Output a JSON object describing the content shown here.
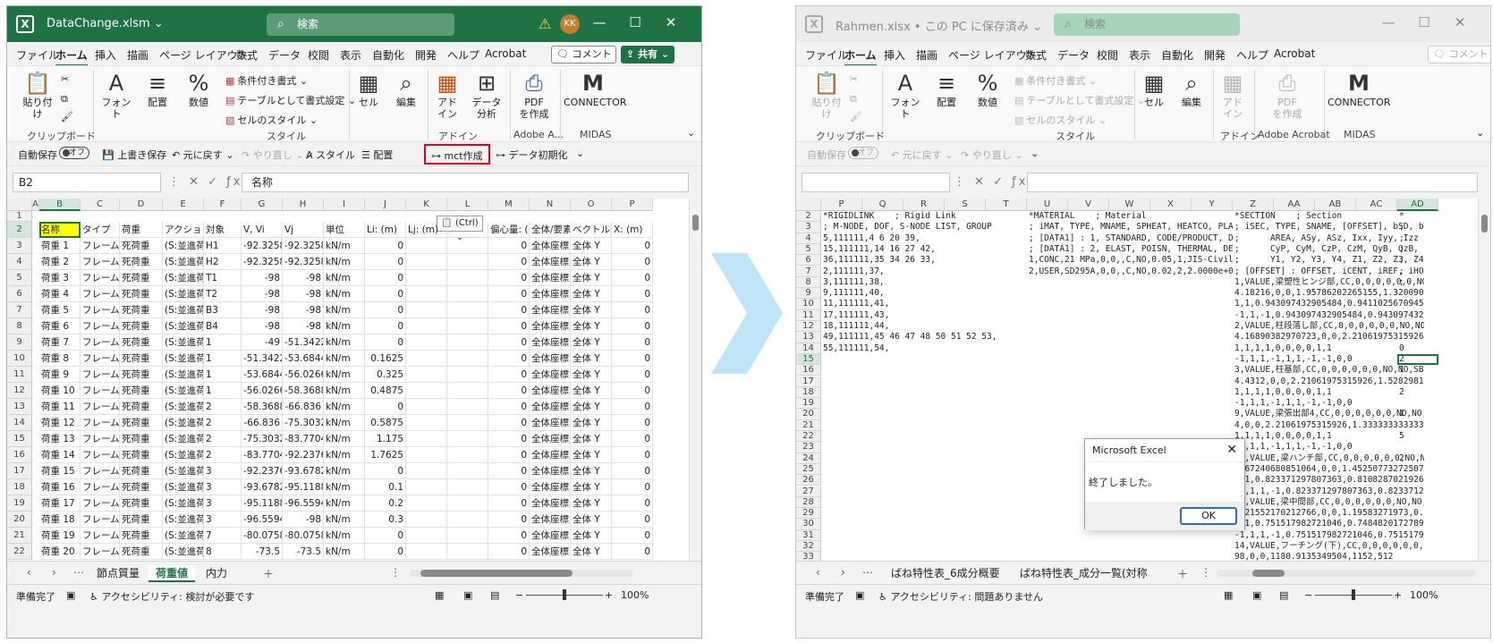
{
  "left": {
    "title": {
      "filename": "DataChange.xlsm ⌄",
      "search": "検索",
      "avatar": "KK"
    },
    "menu": {
      "tabs": [
        "ファイル",
        "ホーム",
        "挿入",
        "描画",
        "ページ レイアウト",
        "数式",
        "データ",
        "校閲",
        "表示",
        "自動化",
        "開発",
        "ヘルプ",
        "Acrobat"
      ],
      "comment": "コメント",
      "share": "共有 ⌄"
    },
    "ribbon": {
      "paste": "貼り付け",
      "font": "フォント",
      "align": "配置",
      "number": "数値",
      "cond_format": "条件付き書式 ⌄",
      "table_format": "テーブルとして書式設定 ⌄",
      "cell_style": "セルのスタイル ⌄",
      "cell": "セル",
      "edit": "編集",
      "addin": "アド\nイン",
      "analyze": "データ\n分析",
      "pdf": "PDF\nを作成",
      "connector": "CONNECTOR",
      "groups": [
        "クリップボード",
        "スタイル",
        "アドイン",
        "Adobe A...",
        "MIDAS"
      ]
    },
    "qat": {
      "autosave": "自動保存",
      "toggle": "オフ",
      "overwrite": "上書き保存",
      "undo": "元に戻す ⌄",
      "redo": "やり直し ⌄",
      "style": "スタイル",
      "align": "配置",
      "mct": "mct作成",
      "init": "データ初期化"
    },
    "formula": {
      "namebox": "B2",
      "value": "名称"
    },
    "columns": [
      "A",
      "B",
      "C",
      "D",
      "E",
      "F",
      "G",
      "H",
      "I",
      "J",
      "K",
      "L",
      "M",
      "N",
      "O",
      "P"
    ],
    "header_row": [
      "名称",
      "タイプ",
      "荷重",
      "アクション",
      "対象",
      "V, Vi",
      "Vj",
      "単位",
      "Li: (m)",
      "Lj: (m)",
      "",
      "偏心量: (",
      "全体/要素",
      "ベクトル方",
      "X: (m)"
    ],
    "ctrl_paste": "(Ctrl)",
    "rows": [
      [
        "荷重 1",
        "フレーム要",
        "死荷重",
        "(S:並進荷重",
        "H1",
        "-92.3258",
        "-92.3258",
        "kN/m",
        "0",
        "",
        "",
        "0",
        "全体座標系",
        "全体 Y",
        "0"
      ],
      [
        "荷重 2",
        "フレーム要",
        "死荷重",
        "(S:並進荷重",
        "H2",
        "-92.3258",
        "-92.3258",
        "kN/m",
        "0",
        "",
        "",
        "0",
        "全体座標系",
        "全体 Y",
        "0"
      ],
      [
        "荷重 3",
        "フレーム要",
        "死荷重",
        "(S:並進荷重",
        "T1",
        "-98",
        "-98",
        "kN/m",
        "0",
        "",
        "",
        "0",
        "全体座標系",
        "全体 Y",
        "0"
      ],
      [
        "荷重 4",
        "フレーム要",
        "死荷重",
        "(S:並進荷重",
        "T2",
        "-98",
        "-98",
        "kN/m",
        "0",
        "",
        "",
        "0",
        "全体座標系",
        "全体 Y",
        "0"
      ],
      [
        "荷重 5",
        "フレーム要",
        "死荷重",
        "(S:並進荷重",
        "B3",
        "-98",
        "-98",
        "kN/m",
        "0",
        "",
        "",
        "0",
        "全体座標系",
        "全体 Y",
        "0"
      ],
      [
        "荷重 6",
        "フレーム要",
        "死荷重",
        "(S:並進荷重",
        "B4",
        "-98",
        "-98",
        "kN/m",
        "0",
        "",
        "",
        "0",
        "全体座標系",
        "全体 Y",
        "0"
      ],
      [
        "荷重 7",
        "フレーム要",
        "死荷重",
        "(S:並進荷重",
        "1",
        "-49",
        "-51.3422",
        "kN/m",
        "0",
        "",
        "",
        "0",
        "全体座標系",
        "全体 Y",
        "0"
      ],
      [
        "荷重 8",
        "フレーム要",
        "死荷重",
        "(S:並進荷重",
        "1",
        "-51.3422",
        "-53.6844",
        "kN/m",
        "0.1625",
        "",
        "",
        "0",
        "全体座標系",
        "全体 Y",
        "0"
      ],
      [
        "荷重 9",
        "フレーム要",
        "死荷重",
        "(S:並進荷重",
        "1",
        "-53.6844",
        "-56.0266",
        "kN/m",
        "0.325",
        "",
        "",
        "0",
        "全体座標系",
        "全体 Y",
        "0"
      ],
      [
        "荷重 10",
        "フレーム要",
        "死荷重",
        "(S:並進荷重",
        "1",
        "-56.0266",
        "-58.3688",
        "kN/m",
        "0.4875",
        "",
        "",
        "0",
        "全体座標系",
        "全体 Y",
        "0"
      ],
      [
        "荷重 11",
        "フレーム要",
        "死荷重",
        "(S:並進荷重",
        "2",
        "-58.3688",
        "-66.836",
        "kN/m",
        "0",
        "",
        "",
        "0",
        "全体座標系",
        "全体 Y",
        "0"
      ],
      [
        "荷重 12",
        "フレーム要",
        "死荷重",
        "(S:並進荷重",
        "2",
        "-66.836",
        "-75.3032",
        "kN/m",
        "0.5875",
        "",
        "",
        "0",
        "全体座標系",
        "全体 Y",
        "0"
      ],
      [
        "荷重 13",
        "フレーム要",
        "死荷重",
        "(S:並進荷重",
        "2",
        "-75.3032",
        "-83.7704",
        "kN/m",
        "1.175",
        "",
        "",
        "0",
        "全体座標系",
        "全体 Y",
        "0"
      ],
      [
        "荷重 14",
        "フレーム要",
        "死荷重",
        "(S:並進荷重",
        "2",
        "-83.7704",
        "-92.2376",
        "kN/m",
        "1.7625",
        "",
        "",
        "0",
        "全体座標系",
        "全体 Y",
        "0"
      ],
      [
        "荷重 15",
        "フレーム要",
        "死荷重",
        "(S:並進荷重",
        "3",
        "-92.2376",
        "-93.6782",
        "kN/m",
        "0",
        "",
        "",
        "0",
        "全体座標系",
        "全体 Y",
        "0"
      ],
      [
        "荷重 16",
        "フレーム要",
        "死荷重",
        "(S:並進荷重",
        "3",
        "-93.6782",
        "-95.1188",
        "kN/m",
        "0.1",
        "",
        "",
        "0",
        "全体座標系",
        "全体 Y",
        "0"
      ],
      [
        "荷重 17",
        "フレーム要",
        "死荷重",
        "(S:並進荷重",
        "3",
        "-95.1188",
        "-96.5594",
        "kN/m",
        "0.2",
        "",
        "",
        "0",
        "全体座標系",
        "全体 Y",
        "0"
      ],
      [
        "荷重 18",
        "フレーム要",
        "死荷重",
        "(S:並進荷重",
        "3",
        "-96.5594",
        "-98",
        "kN/m",
        "0.3",
        "",
        "",
        "0",
        "全体座標系",
        "全体 Y",
        "0"
      ],
      [
        "荷重 19",
        "フレーム要",
        "死荷重",
        "(S:並進荷重",
        "7",
        "-80.0758",
        "-80.0758",
        "kN/m",
        "0",
        "",
        "",
        "0",
        "全体座標系",
        "全体 Y",
        "0"
      ],
      [
        "荷重 20",
        "フレーム要",
        "死荷重",
        "(S:並進荷重",
        "8",
        "-73.5",
        "-73.5",
        "kN/m",
        "0",
        "",
        "",
        "0",
        "全体座標系",
        "全体 Y",
        "0"
      ]
    ],
    "row_numbers": [
      "1",
      "2",
      "3",
      "4",
      "5",
      "6",
      "7",
      "8",
      "9",
      "10",
      "11",
      "12",
      "13",
      "14",
      "15",
      "16",
      "17",
      "18",
      "19",
      "20",
      "21",
      "22"
    ],
    "sheets": [
      "節点質量",
      "荷重値",
      "内力"
    ],
    "status": {
      "ready": "準備完了",
      "access": "アクセシビリティ: 検討が必要です",
      "zoom": "100%"
    }
  },
  "right": {
    "title": {
      "filename": "Rahmen.xlsx • この PC に保存済み ⌄",
      "search": "検索"
    },
    "menu": {
      "tabs": [
        "ファイル",
        "ホーム",
        "挿入",
        "描画",
        "ページ レイアウト",
        "数式",
        "データ",
        "校閲",
        "表示",
        "自動化",
        "開発",
        "ヘルプ",
        "Acrobat"
      ],
      "comment": "コメント"
    },
    "ribbon": {
      "paste": "貼り付け",
      "font": "フォント",
      "align": "配置",
      "number": "数値",
      "cond_format": "条件付き書式 ⌄",
      "table_format": "テーブルとして書式設定 ⌄",
      "cell_style": "セルのスタイル ⌄",
      "cell": "セル",
      "edit": "編集",
      "addin": "アド\nイン",
      "pdf": "PDF\nを作成",
      "connector": "CONNECTOR",
      "groups": [
        "クリップボード",
        "スタイル",
        "アドイン",
        "Adobe Acrobat",
        "MIDAS"
      ]
    },
    "qat": {
      "autosave": "自動保存",
      "toggle": "オフ",
      "undo": "元に戻す ⌄",
      "redo": "やり直し ⌄"
    },
    "columns": [
      "P",
      "Q",
      "R",
      "S",
      "T",
      "U",
      "V",
      "W",
      "X",
      "Y",
      "Z",
      "AA",
      "AB",
      "AC",
      "AD"
    ],
    "row_numbers": [
      "2",
      "3",
      "4",
      "5",
      "6",
      "7",
      "8",
      "9",
      "10",
      "11",
      "12",
      "13",
      "14",
      "15",
      "16",
      "17",
      "18",
      "19",
      "20",
      "21",
      "22",
      "23",
      "24",
      "25",
      "26",
      "27",
      "28",
      "29",
      "30",
      "31",
      "32",
      "33"
    ],
    "col_p": [
      "*RIGIDLINK    ; Rigid Link",
      "; M-NODE, DOF, S-NODE LIST, GROUP",
      "5,111111,4 6 20 39,",
      "15,111111,14 16 27 42,",
      "36,111111,35 34 26 33,",
      "2,111111,37,",
      "3,111111,38,",
      "9,111111,40,",
      "11,111111,41,",
      "17,111111,43,",
      "18,111111,44,",
      "49,111111,45 46 47 48 50 51 52 53,",
      "55,111111,54,"
    ],
    "col_u": [
      "*MATERIAL    ; Material",
      "; iMAT, TYPE, MNAME, SPHEAT, HEATCO, PLAST, TUI",
      "; [DATA1] : 1, STANDARD, CODE/PRODUCT, DB, USE",
      "; [DATA1] : 2, ELAST, POISN, THERMAL, DEN, MAS",
      "1,CONC,21 MPa,0,0,,C,NO,0.05,1,JIS-Civil(RC),,F",
      "2,USER,SD295A,0,0,,C,NO,0.02,2,2.0000e+08,0.3,0.0"
    ],
    "col_z": [
      "*SECTION    ; Section",
      "; iSEC, TYPE, SNAME, [OFFSET], bSD, bWE, SHAPE",
      ";      AREA, ASy, ASz, Ixx, Iyy, Izz",
      ";      CyP, CyM, CzP, CzM, QyB, QzB, PERI_OUT",
      ";      Y1, Y2, Y3, Y4, Z1, Z2, Z3, Z4, Zyy, Z",
      "; [OFFSET] : OFFSET, iCENT, iREF, iHORZ, HUSER",
      "1,VALUE,梁塑性ヒンジ部,CC,0,0,0,0,0,0,NO,NO,SB",
      "4.18216,0,0,1.95786202265155,1.32009021491035,",
      "1,1,0.943097432905484,0.941102567094516,0,0,0,",
      "-1,1,-1,0.943097432905484,0.943097432905484,0,",
      "2,VALUE,柱段落し部,CC,0,0,0,0,0,0,NO,NO,SB,BUI",
      "4.16890382970723,0,0,2.21061975315926,1.404180",
      "1,1,1,1,0,0,0,0,1,1",
      "-1,1,1,-1,1,1,-1,-1,0,0",
      "3,VALUE,柱基部,CC,0,0,0,0,0,0,NO,NO,SB,BUILT,0",
      "4.4312,0,0,2.21061975315926,1.52829818758865,1",
      "1,1,1,1,0,0,0,0,1,1",
      "-1,1,1,-1,1,1,-1,-1,0,0",
      "9,VALUE,梁張出部4,CC,0,0,0,0,0,0,NO,NO,SB,BUIL",
      "4,0,0,2.21061975315926,1.33333333333333,1.3333",
      "1,1,1,1,0,0,0,0,1,1",
      "-1,1,1,-1,1,1,-1,-1,0,0",
      "11,VALUE,梁ハンチ部,CC,0,0,0,0,0,0,NO,NO,SB,BU",
      "3.67240680851064,0,0,1.45250773272507,0.891442",
      "1,1,0.823371297807363,0.810828702192637,0,0,0,",
      "-1,1,1,-1,0.823371297807363,0.823371297807363,",
      "12,VALUE,梁中間部,CC,0,0,0,0,0,0,NO,NO,SB,BUIL",
      "3.21552170212766,0,0,1.19583271973,0.6468451",
      "1,1,0.751517982721046,0.748482017278954,0,0,0,",
      "-1,1,1,-1,0.751517982721046,0.751517982721046,",
      "14,VALUE,フーチング(下),CC,0,0,0,0,0,0,NO,NO,S",
      "98,0,0,1180.9135349504,1152,512"
    ],
    "col_ad": [
      "*",
      "; ",
      ";",
      ";",
      ";",
      ";",
      ";",
      "",
      "",
      "",
      "",
      "",
      "0",
      "2",
      "1",
      "",
      "2",
      "",
      "1",
      "",
      "5",
      "",
      "2",
      "",
      "",
      "",
      "",
      "",
      "",
      "",
      "",
      ""
    ],
    "dialog": {
      "title": "Microsoft Excel",
      "message": "終了しました。",
      "ok": "OK"
    },
    "sheets": [
      "ばね特性表_6成分概要",
      "ばね特性表_成分一覧(対称"
    ],
    "status": {
      "ready": "準備完了",
      "access": "アクセシビリティ: 問題ありません",
      "zoom": "100%"
    }
  },
  "colors": {
    "excel_green": "#1f7244",
    "highlight_red": "#e3001b",
    "arrow_blue": "#bfe4f6",
    "selected_yellow": "#ffff00"
  }
}
